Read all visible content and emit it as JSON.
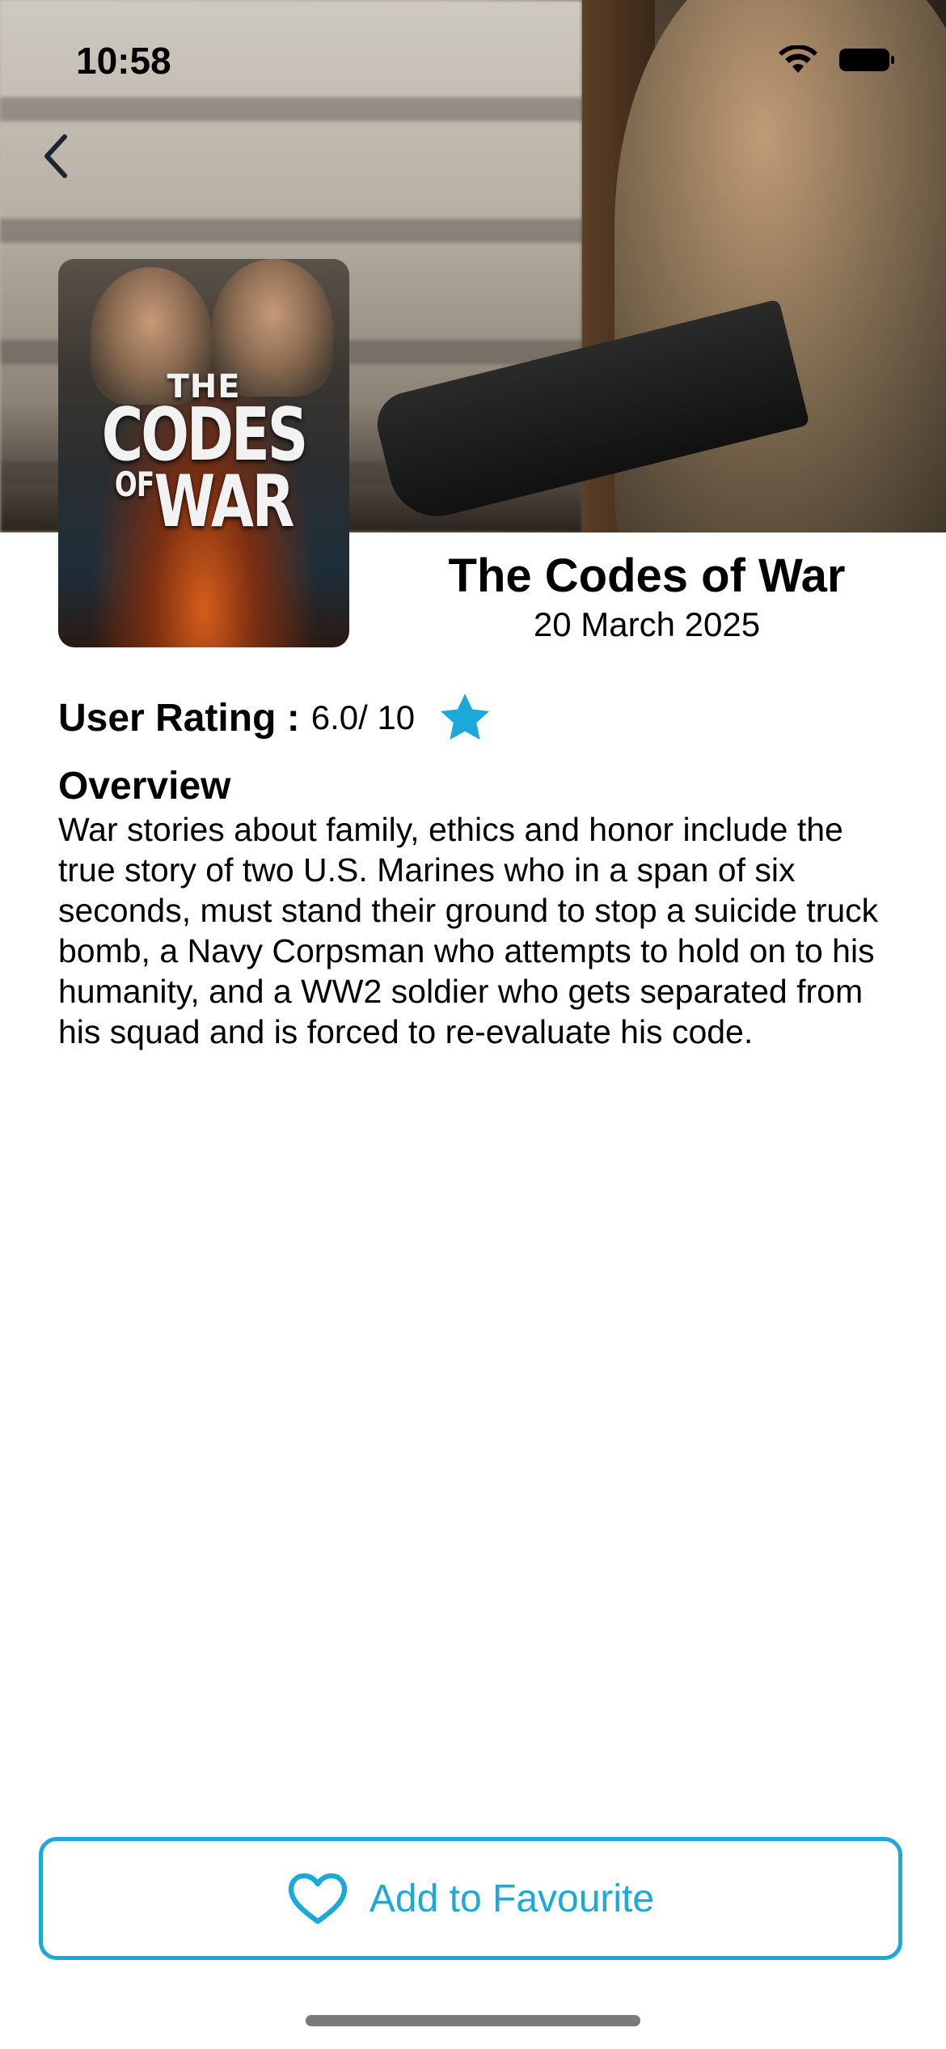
{
  "status_bar": {
    "time": "10:58"
  },
  "nav": {
    "back_icon": "chevron-left-icon"
  },
  "movie": {
    "poster_text": {
      "line1": "THE",
      "line2": "CODES",
      "line3_small": "OF",
      "line3": "WAR"
    },
    "title": "The Codes of War",
    "release_date": "20 March 2025",
    "rating_label": "User Rating :",
    "rating_value": "6.0/ 10",
    "rating_icon": "star-icon",
    "overview_heading": "Overview",
    "overview_text": "War stories about family, ethics and honor include the true story of two U.S. Marines who in a span of six seconds, must stand their ground to stop a suicide truck bomb, a Navy Corpsman who attempts to hold on to his humanity, and a WW2 soldier who gets separated from his squad and is forced to re-evaluate his code."
  },
  "actions": {
    "favourite_label": "Add to Favourite",
    "favourite_icon": "heart-outline-icon"
  },
  "colors": {
    "accent": "#1aa9d8",
    "star": "#1aa9d8"
  }
}
